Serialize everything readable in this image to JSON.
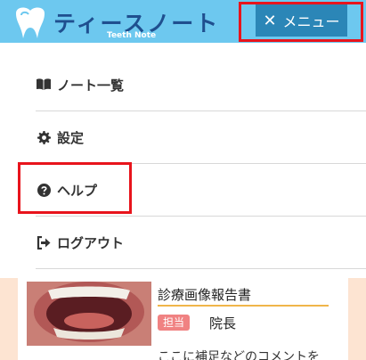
{
  "header": {
    "logo_title": "ティースノート",
    "logo_subtitle": "Teeth Note",
    "menu_button": {
      "icon": "close-icon",
      "label": "メニュー"
    }
  },
  "menu": {
    "items": [
      {
        "icon": "book-icon",
        "label": "ノート一覧"
      },
      {
        "icon": "gear-icon",
        "label": "設定"
      },
      {
        "icon": "question-circle-icon",
        "label": "ヘルプ"
      },
      {
        "icon": "sign-out-icon",
        "label": "ログアウト"
      }
    ]
  },
  "card": {
    "title": "診療画像報告書",
    "role_badge": "担当",
    "role_value": "院長",
    "comment": "ここに補足などのコメントを"
  },
  "colors": {
    "header_bg": "#6dc8ef",
    "menu_button_bg": "#2b86b7",
    "highlight_outline": "#e8141c",
    "content_bg": "#fde4d2",
    "badge_bg": "#f08282",
    "title_underline": "#f0b54a"
  }
}
